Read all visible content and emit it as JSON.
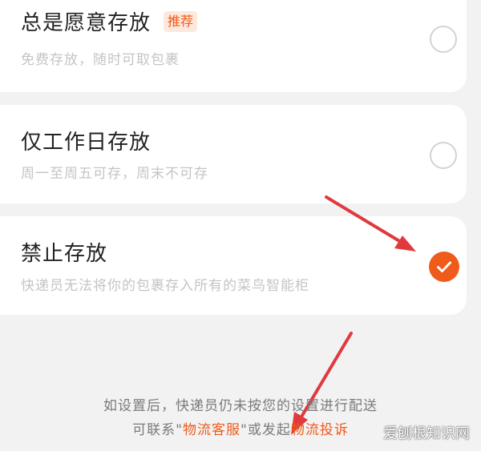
{
  "options": [
    {
      "title": "总是愿意存放",
      "badge": "推荐",
      "description": "免费存放，随时可取包裹",
      "selected": false
    },
    {
      "title": "仅工作日存放",
      "description": "周一至周五可存，周末不可存",
      "selected": false
    },
    {
      "title": "禁止存放",
      "description": "快递员无法将你的包裹存入所有的菜鸟智能柜",
      "selected": true
    }
  ],
  "footer": {
    "line1": "如设置后，快递员仍未按您的设置进行配送",
    "line2_prefix": "可联系\"",
    "customer_service_link": "物流客服",
    "line2_middle": "\"或发起",
    "complaint_link": "物流投诉"
  },
  "watermark": "爱刨根知识网",
  "colors": {
    "accent": "#f05a1a",
    "annotation_arrow": "#e0393e",
    "background": "#f2f2f2"
  },
  "icons": {
    "selected_radio": "check-icon",
    "annotation": "arrow-icon"
  }
}
